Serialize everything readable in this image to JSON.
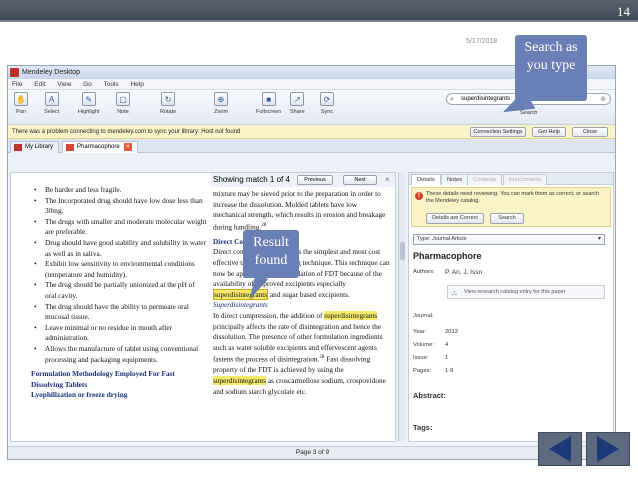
{
  "slide": {
    "page_number": "14",
    "date": "5/17/2018"
  },
  "window": {
    "title": "Mendeley Desktop",
    "menu": [
      "File",
      "Edit",
      "View",
      "Go",
      "Tools",
      "Help"
    ]
  },
  "toolbar": {
    "buttons": [
      {
        "label": "Pan",
        "icon": "hand-icon",
        "glyph": "✋"
      },
      {
        "label": "Select",
        "icon": "text-select-icon",
        "glyph": "A"
      },
      {
        "label": "Highlight",
        "icon": "highlighter-icon",
        "glyph": "✎"
      },
      {
        "label": "Note",
        "icon": "note-icon",
        "glyph": "▢"
      },
      {
        "label": "Rotate",
        "icon": "rotate-icon",
        "glyph": "↻"
      },
      {
        "label": "Zoom",
        "icon": "zoom-icon",
        "glyph": "⊕"
      },
      {
        "label": "Fullscreen",
        "icon": "fullscreen-icon",
        "glyph": "■"
      },
      {
        "label": "Share",
        "icon": "share-icon",
        "glyph": "↗"
      },
      {
        "label": "Sync",
        "icon": "sync-icon",
        "glyph": "⟳"
      }
    ],
    "search": {
      "value": "superdisintegrants",
      "label": "Search"
    }
  },
  "warning": {
    "text": "There was a problem connecting to mendeley.com to sync your library: Host not found",
    "buttons": [
      "Connection Settings",
      "Get Help",
      "Close"
    ]
  },
  "tabs": [
    "My Library",
    "Pharmacophore"
  ],
  "find": {
    "status": "Showing match 1 of 4",
    "prev": "Previous",
    "next": "Next"
  },
  "document": {
    "left_bullets": [
      "Be harder and less fragile.",
      "The Incorporated drug should have low dose less than 30mg.",
      "The drugs with smaller and moderate molecular weight are preferable.",
      "Drug should have good stability and solubility in water as well as in saliva.",
      "Exhibit low sensitivity to environmental conditions (temperature and humidity).",
      "The drug should be partially unionized at the pH of oral cavity.",
      "The drug should have the ability to permeate oral mucosal tissue.",
      "Leave minimal or no residue in mouth after administration.",
      "Allows the manufacture of tablet using conventional processing and packaging equipments."
    ],
    "left_heading1": "Formulation Methodology Employed For Fast Dissolving Tablets",
    "left_heading2": "Lyophilization or freeze drying",
    "right_p1": "mixture may be sieved prior to the preparation in order to increase the dissolution. Molded tablets have low mechanical strength, which results in erosion and breakage during handling.",
    "right_p1_sup": "28",
    "right_heading": "Direct Compression",
    "right_p2_start": "Direct compression represents the simplest and most cost effective tablet manufacturing technique. This technique can now be applied for the formulation of FDT because of the availability of improved excipients especially",
    "match1": "superdisintegrants",
    "right_p2_end": "and sugar based excipients.",
    "right_subheading": "Superdisintegrants",
    "right_p3a": "In direct compression, the addition of",
    "match2": "superdisintegrants",
    "right_p3b": "principally affects the rate of disintegration and hence the dissolution. The presence of other formulation ingredients such as water soluble excipients and effervescent agents fastens the process of disintegration.",
    "right_p3_sup": "28",
    "right_p3c": "Fast dissolving property of the FDT is achieved by using the",
    "match3": "superdisintegrants",
    "right_p3d": "as croscarmellose sodium, crospovidone and sodium starch glycolate etc."
  },
  "details": {
    "tabs": [
      "Details",
      "Notes",
      "Contents",
      "Enrichments"
    ],
    "notice": "These details need reviewing. You can mark them as correct, or search the Mendeley catalog.",
    "notice_buttons": [
      "Details are Correct",
      "Search"
    ],
    "type": "Type: Journal Article",
    "title": "Pharmacophore",
    "authors_label": "Authors:",
    "authors": "P. An, J. Issn",
    "catalog_link": "View research catalog entry for this paper",
    "journal_label": "Journal:",
    "year_label": "Year:",
    "year": "2013",
    "volume_label": "Volume:",
    "volume": "4",
    "issue_label": "Issue:",
    "issue": "1",
    "pages_label": "Pages:",
    "pages": "1-9",
    "abstract_label": "Abstract:",
    "tags_label": "Tags:"
  },
  "status": {
    "page": "Page 3 of 9"
  },
  "callouts": {
    "search": "Search as you type",
    "result": "Result found"
  },
  "colors": {
    "highlight": "#f7e96a",
    "callout": "#6a7fb5",
    "heading": "#1a2f7a"
  }
}
